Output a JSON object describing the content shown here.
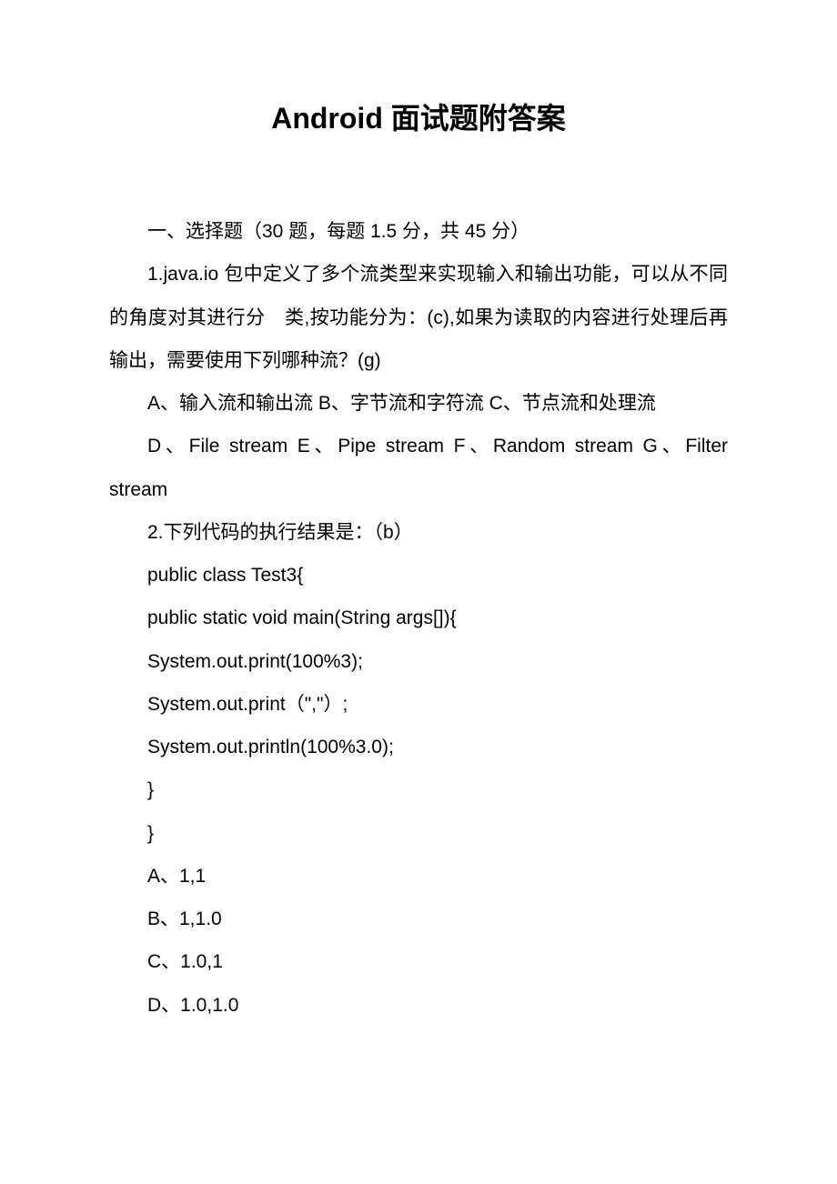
{
  "title": "Android 面试题附答案",
  "section_header": "一、选择题（30 题，每题 1.5 分，共 45 分）",
  "q1": {
    "text": "1.java.io 包中定义了多个流类型来实现输入和输出功能，可以从不同的角度对其进行分　类,按功能分为：(c),如果为读取的内容进行处理后再输出，需要使用下列哪种流？(g)",
    "options_line1": "A、输入流和输出流  B、字节流和字符流  C、节点流和处理流",
    "options_line2": "D、File   stream   E、Pipe   stream   F、Random   stream G、Filter stream"
  },
  "q2": {
    "text": "2.下列代码的执行结果是：（b）",
    "code1": "public class Test3{",
    "code2": "public static void main(String args[]){",
    "code3": "System.out.print(100%3);",
    "code4": "System.out.print（\",\"）;",
    "code5": "System.out.println(100%3.0);",
    "code6": "}",
    "code7": "}",
    "optA": "A、1,1",
    "optB": "B、1,1.0",
    "optC": "C、1.0,1",
    "optD": "D、1.0,1.0"
  }
}
